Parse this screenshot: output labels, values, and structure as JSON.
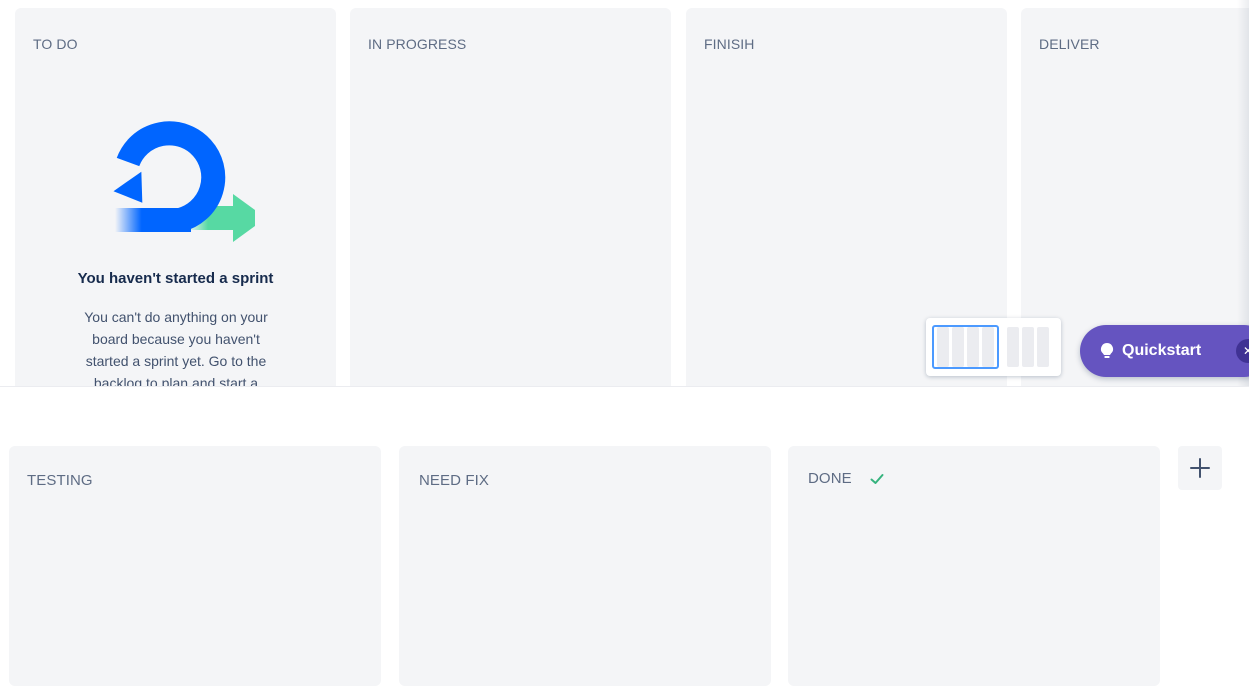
{
  "board": {
    "top_columns": [
      {
        "name": "TO DO"
      },
      {
        "name": "IN PROGRESS"
      },
      {
        "name": "FINISIH"
      },
      {
        "name": "DELIVER"
      }
    ],
    "bottom_columns": [
      {
        "name": "TESTING"
      },
      {
        "name": "NEED FIX"
      },
      {
        "name": "DONE"
      }
    ],
    "empty_state": {
      "title": "You haven't started a sprint",
      "description": "You can't do anything on your board because you haven't started a sprint yet. Go to the backlog to plan and start a"
    },
    "quickstart_label": "Quickstart",
    "icons": {
      "sprint": "sprint-cycle-icon",
      "done": "check-icon",
      "add": "plus-icon",
      "quickstart": "lightbulb-icon",
      "close": "close-icon"
    },
    "colors": {
      "column_bg": "#f4f5f7",
      "header_text": "#5e6c84",
      "quickstart_bg": "#6554c0",
      "switcher_active_border": "#4c9aff",
      "done_check": "#36b37e",
      "sprint_blue": "#0065ff",
      "sprint_green": "#57d9a3"
    }
  }
}
